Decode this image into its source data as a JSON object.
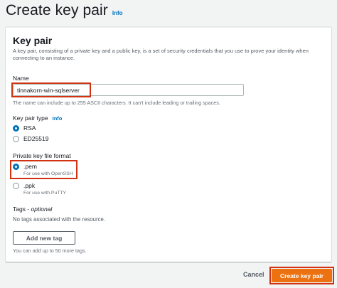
{
  "header": {
    "title": "Create key pair",
    "info_label": "Info"
  },
  "card": {
    "title": "Key pair",
    "description": "A key pair, consisting of a private key and a public key, is a set of security credentials that you use to prove your identity when connecting to an instance."
  },
  "name_field": {
    "label": "Name",
    "value": "tinnakorn-win-sqlserver",
    "hint": "The name can include up to 255 ASCII characters. It can't include leading or trailing spaces."
  },
  "key_pair_type": {
    "label": "Key pair type",
    "info_label": "Info",
    "options": [
      {
        "label": "RSA",
        "checked": true
      },
      {
        "label": "ED25519",
        "checked": false
      }
    ]
  },
  "file_format": {
    "label": "Private key file format",
    "options": [
      {
        "label": ".pem",
        "sub": "For use with OpenSSH",
        "checked": true
      },
      {
        "label": ".ppk",
        "sub": "For use with PuTTY",
        "checked": false
      }
    ]
  },
  "tags": {
    "label": "Tags - ",
    "optional": "optional",
    "empty_text": "No tags associated with the resource.",
    "add_button": "Add new tag",
    "limit_hint": "You can add up to 50 more tags."
  },
  "footer": {
    "cancel_label": "Cancel",
    "create_label": "Create key pair"
  },
  "colors": {
    "primary": "#ec7211",
    "link": "#0073bb",
    "highlight": "#d13212"
  }
}
